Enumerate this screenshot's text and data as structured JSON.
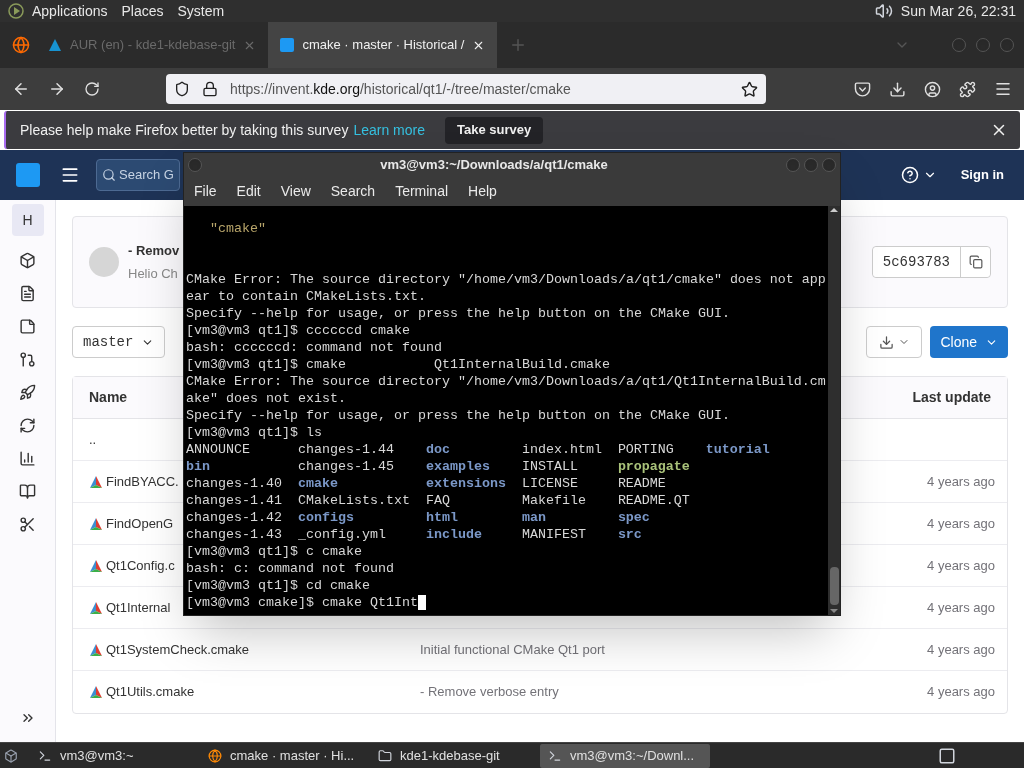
{
  "top_panel": {
    "menus": [
      "Applications",
      "Places",
      "System"
    ],
    "clock": "Sun Mar 26, 22:31"
  },
  "browser": {
    "tabs": [
      {
        "label": "AUR (en) - kde1-kdebase-git",
        "selected": false
      },
      {
        "label": "cmake · master · Historical /",
        "selected": true
      }
    ],
    "url": {
      "before": "https://invent.",
      "domain": "kde.org",
      "after": "/historical/qt1/-/tree/master/cmake"
    }
  },
  "survey": {
    "message": "Please help make Firefox better by taking this survey",
    "link": "Learn more",
    "button": "Take survey"
  },
  "gitlab": {
    "search_placeholder": "Search G",
    "sign_in": "Sign in",
    "avatar_letter": "H",
    "commit": {
      "title": "- Remov",
      "author": "Helio Ch",
      "sha": "5c693783"
    },
    "branch": "master",
    "clone": "Clone",
    "columns": [
      "Name",
      "Last update"
    ],
    "rows": [
      {
        "kind": "parent",
        "name": ".."
      },
      {
        "kind": "file",
        "name": "FindBYACC.",
        "updated": "4 years ago"
      },
      {
        "kind": "file",
        "name": "FindOpenG",
        "updated": "4 years ago"
      },
      {
        "kind": "file",
        "name": "Qt1Config.c",
        "updated": "4 years ago"
      },
      {
        "kind": "file",
        "name": "Qt1Internal",
        "updated": "4 years ago"
      },
      {
        "kind": "file",
        "name": "Qt1SystemCheck.cmake",
        "message": "Initial functional CMake Qt1 port",
        "updated": "4 years ago"
      },
      {
        "kind": "file",
        "name": "Qt1Utils.cmake",
        "message": "- Remove verbose entry",
        "updated": "4 years ago"
      }
    ]
  },
  "terminal": {
    "title": "vm3@vm3:~/Downloads/a/qt1/cmake",
    "menus": [
      "File",
      "Edit",
      "View",
      "Search",
      "Terminal",
      "Help"
    ],
    "lines": [
      {
        "kind": "quoted",
        "text": "\"cmake\""
      },
      {
        "kind": "blank"
      },
      {
        "kind": "blank"
      },
      {
        "kind": "text",
        "text": "CMake Error: The source directory \"/home/vm3/Downloads/a/qt1/cmake\" does not app"
      },
      {
        "kind": "text",
        "text": "ear to contain CMakeLists.txt."
      },
      {
        "kind": "text",
        "text": "Specify --help for usage, or press the help button on the CMake GUI."
      },
      {
        "kind": "text",
        "text": "[vm3@vm3 qt1]$ ccccccd cmake"
      },
      {
        "kind": "text",
        "text": "bash: ccccccd: command not found"
      },
      {
        "kind": "text",
        "text": "[vm3@vm3 qt1]$ cmake           Qt1InternalBuild.cmake"
      },
      {
        "kind": "text",
        "text": "CMake Error: The source directory \"/home/vm3/Downloads/a/qt1/Qt1InternalBuild.cm"
      },
      {
        "kind": "text",
        "text": "ake\" does not exist."
      },
      {
        "kind": "text",
        "text": "Specify --help for usage, or press the help button on the CMake GUI."
      },
      {
        "kind": "text",
        "text": "[vm3@vm3 qt1]$ ls"
      },
      {
        "kind": "listing",
        "cells": [
          {
            "text": "ANNOUNCE",
            "kind": "file"
          },
          {
            "text": "changes-1.44",
            "kind": "file"
          },
          {
            "text": "doc",
            "kind": "dir"
          },
          {
            "text": "index.html",
            "kind": "file"
          },
          {
            "text": "PORTING",
            "kind": "file"
          },
          {
            "text": "tutorial",
            "kind": "dir"
          }
        ]
      },
      {
        "kind": "listing",
        "cells": [
          {
            "text": "bin",
            "kind": "dir"
          },
          {
            "text": "changes-1.45",
            "kind": "file"
          },
          {
            "text": "examples",
            "kind": "dir"
          },
          {
            "text": "INSTALL",
            "kind": "file"
          },
          {
            "text": "propagate",
            "kind": "exec"
          }
        ]
      },
      {
        "kind": "listing",
        "cells": [
          {
            "text": "changes-1.40",
            "kind": "file"
          },
          {
            "text": "cmake",
            "kind": "dir"
          },
          {
            "text": "extensions",
            "kind": "dir"
          },
          {
            "text": "LICENSE",
            "kind": "file"
          },
          {
            "text": "README",
            "kind": "file"
          }
        ]
      },
      {
        "kind": "listing",
        "cells": [
          {
            "text": "changes-1.41",
            "kind": "file"
          },
          {
            "text": "CMakeLists.txt",
            "kind": "file"
          },
          {
            "text": "FAQ",
            "kind": "file"
          },
          {
            "text": "Makefile",
            "kind": "file"
          },
          {
            "text": "README.QT",
            "kind": "file"
          }
        ]
      },
      {
        "kind": "listing",
        "cells": [
          {
            "text": "changes-1.42",
            "kind": "file"
          },
          {
            "text": "configs",
            "kind": "dir"
          },
          {
            "text": "html",
            "kind": "dir"
          },
          {
            "text": "man",
            "kind": "dir"
          },
          {
            "text": "spec",
            "kind": "dir"
          }
        ]
      },
      {
        "kind": "listing",
        "cells": [
          {
            "text": "changes-1.43",
            "kind": "file"
          },
          {
            "text": "_config.yml",
            "kind": "file"
          },
          {
            "text": "include",
            "kind": "dir"
          },
          {
            "text": "MANIFEST",
            "kind": "file"
          },
          {
            "text": "src",
            "kind": "dir"
          }
        ]
      },
      {
        "kind": "text",
        "text": "[vm3@vm3 qt1]$ c cmake"
      },
      {
        "kind": "text",
        "text": "bash: c: command not found"
      },
      {
        "kind": "text",
        "text": "[vm3@vm3 qt1]$ cd cmake"
      },
      {
        "kind": "prompt",
        "text": "[vm3@vm3 cmake]$ cmake Qt1Int",
        "cursor": true
      }
    ]
  },
  "taskbar": {
    "items": [
      {
        "kind": "terminal",
        "label": "vm3@vm3:~",
        "selected": false
      },
      {
        "kind": "browser",
        "label": "cmake · master · Hi...",
        "selected": false
      },
      {
        "kind": "folder",
        "label": "kde1-kdebase-git",
        "selected": false
      },
      {
        "kind": "terminal",
        "label": "vm3@vm3:~/Downl...",
        "selected": true
      }
    ]
  }
}
